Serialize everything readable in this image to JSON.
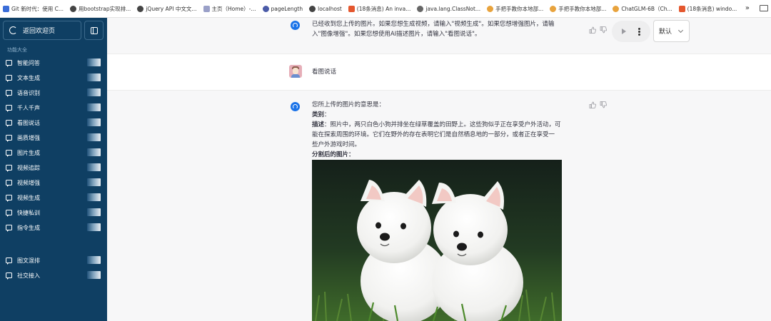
{
  "bookmarks": [
    {
      "label": "Git 新时代：使用 C...",
      "icon": "git-favicon",
      "color": "#3b6dd8"
    },
    {
      "label": "用bootstrap实现排...",
      "icon": "globe-icon",
      "color": "#444444"
    },
    {
      "label": "jQuery API 中文文...",
      "icon": "globe-icon",
      "color": "#444444"
    },
    {
      "label": "主页（Home）-...",
      "icon": "wiki-favicon",
      "color": "#9aa0c8"
    },
    {
      "label": "pageLength",
      "icon": "datatables-favicon",
      "color": "#4b5ba8"
    },
    {
      "label": "localhost",
      "icon": "globe-icon",
      "color": "#444444"
    },
    {
      "label": "(18条消息) An inva...",
      "icon": "csdn-favicon",
      "color": "#e4572e"
    },
    {
      "label": "java.lang.ClassNot...",
      "icon": "link-favicon",
      "color": "#666666"
    },
    {
      "label": "手把手教你本地部...",
      "icon": "chrome-favicon",
      "color": "#e8a33d"
    },
    {
      "label": "手把手教你本地部...",
      "icon": "chrome-favicon",
      "color": "#e8a33d"
    },
    {
      "label": "ChatGLM-6B（Ch...",
      "icon": "chrome-favicon",
      "color": "#e8a33d"
    },
    {
      "label": "(18条消息) windo...",
      "icon": "csdn-favicon",
      "color": "#e4572e"
    }
  ],
  "bookmarks_more": "»",
  "sidebar": {
    "back_label": "返回欢迎页",
    "section_title": "功能大全",
    "items": [
      {
        "label": "智能问答"
      },
      {
        "label": "文本生成"
      },
      {
        "label": "语音识别"
      },
      {
        "label": "千人千声"
      },
      {
        "label": "看图说话"
      },
      {
        "label": "画质增强"
      },
      {
        "label": "图片生成"
      },
      {
        "label": "视频追踪"
      },
      {
        "label": "视频增强"
      },
      {
        "label": "视频生成"
      },
      {
        "label": "快捷私训"
      },
      {
        "label": "指令生成"
      }
    ],
    "extra_items": [
      {
        "label": "图文混排"
      },
      {
        "label": "社交接入"
      }
    ]
  },
  "chat": {
    "top_message": {
      "line1": "已经收到您上传的图片。如果您想生成视频，请输入\"视频生成\"。如果您想增强图片，请输",
      "line2": "入\"图像增强\"。如果您想使用AI描述图片，请输入\"看图说话\"。"
    },
    "select_value": "默认",
    "user_message": "看图说话",
    "bot_message": {
      "intro": "您所上传的图片的意思是：",
      "category_label": "类别",
      "category_value": "：",
      "desc_label": "描述",
      "desc_line1": "：照片中，两只白色小狗并排坐在绿草覆盖的田野上。这些狗似乎正在享受户外活动，可",
      "desc_line2": "能在探索周围的环境。它们在野外的存在表明它们是自然栖息地的一部分，或者正在享受一",
      "desc_line3": "些户外游戏时间。",
      "image_label": "分割后的图片："
    }
  },
  "colors": {
    "sidebar_bg": "#0f3f63",
    "accent": "#1a73e8",
    "message_bg": "#f7f7f8"
  }
}
